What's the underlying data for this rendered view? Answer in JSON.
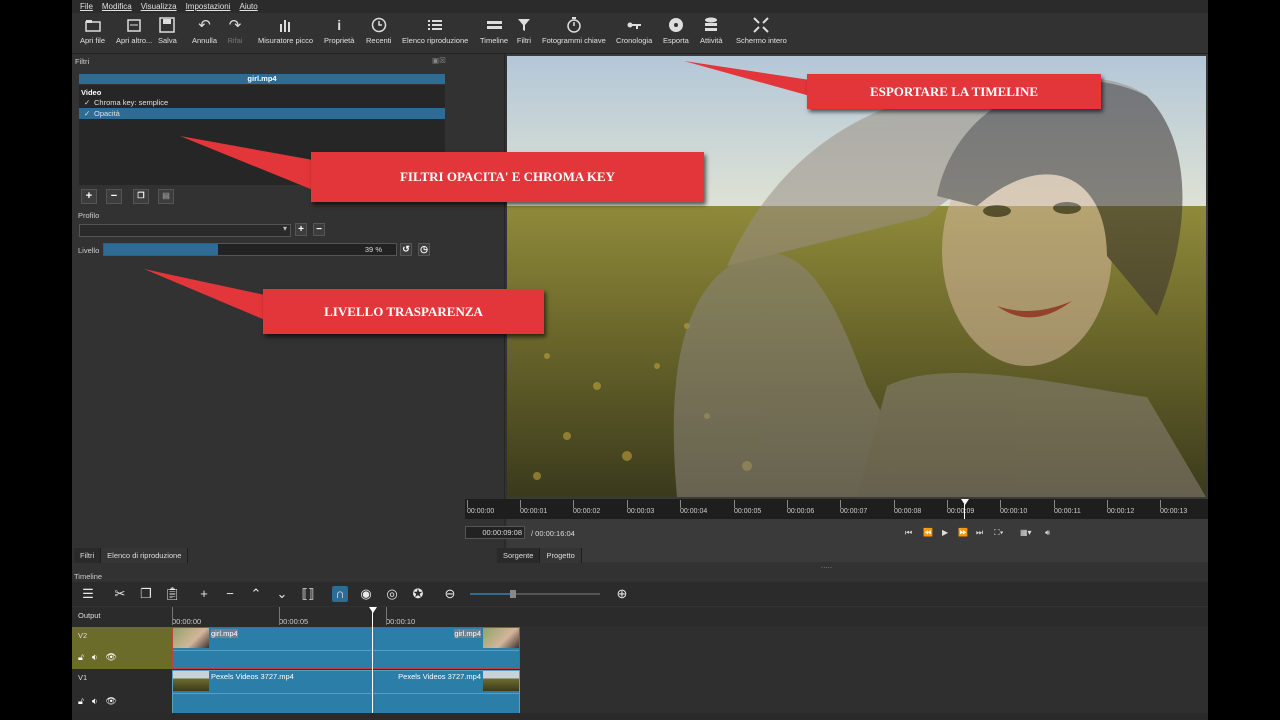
{
  "menu": [
    "File",
    "Modifica",
    "Visualizza",
    "Impostazioni",
    "Aiuto"
  ],
  "toolbar": [
    {
      "label": "Apri file",
      "icon": "folder-icon"
    },
    {
      "label": "Apri altro...",
      "icon": "folder-open-icon"
    },
    {
      "label": "Salva",
      "icon": "save-icon"
    },
    {
      "label": "Annulla",
      "icon": "undo-icon"
    },
    {
      "label": "Rifai",
      "icon": "redo-icon"
    },
    {
      "label": "Misuratore picco",
      "icon": "peak-meter-icon"
    },
    {
      "label": "Proprietà",
      "icon": "info-icon"
    },
    {
      "label": "Recenti",
      "icon": "clock-icon"
    },
    {
      "label": "Elenco riproduzione",
      "icon": "list-icon"
    },
    {
      "label": "Timeline",
      "icon": "timeline-icon"
    },
    {
      "label": "Filtri",
      "icon": "filter-icon"
    },
    {
      "label": "Fotogrammi chiave",
      "icon": "stopwatch-icon"
    },
    {
      "label": "Cronologia",
      "icon": "history-icon"
    },
    {
      "label": "Esporta",
      "icon": "export-disc-icon"
    },
    {
      "label": "Attività",
      "icon": "jobs-icon"
    },
    {
      "label": "Schermo intero",
      "icon": "fullscreen-icon"
    }
  ],
  "filters_panel": {
    "title": "Filtri",
    "clip_name": "girl.mp4",
    "group": "Video",
    "items": [
      {
        "check": "✓",
        "label": "Chroma key: semplice"
      },
      {
        "check": "✓",
        "label": "Opacità"
      }
    ],
    "profile_label": "Profilo",
    "level_label": "Livello",
    "level_value": "39 %",
    "level_fraction": 0.39
  },
  "left_tabs": [
    "Filtri",
    "Elenco di riproduzione"
  ],
  "player": {
    "ruler": [
      "00:00:00",
      "00:00:01",
      "00:00:02",
      "00:00:03",
      "00:00:04",
      "00:00:05",
      "00:00:06",
      "00:00:07",
      "00:00:08",
      "00:00:09",
      "00:00:10",
      "00:00:11",
      "00:00:12",
      "00:00:13"
    ],
    "current_time": "00:00:09:08",
    "total_time": "/ 00:00:16:04",
    "tabs": [
      "Sorgente",
      "Progetto"
    ]
  },
  "timeline": {
    "label": "Timeline",
    "ruler": [
      "00:00:00",
      "00:00:05",
      "00:00:10"
    ],
    "output_label": "Output",
    "tracks": [
      {
        "name": "V2",
        "clips": [
          "girl.mp4",
          "girl.mp4"
        ]
      },
      {
        "name": "V1",
        "clips": [
          "Pexels Videos 3727.mp4",
          "Pexels Videos 3727.mp4"
        ]
      }
    ]
  },
  "callouts": {
    "export": "ESPORTARE LA TIMELINE",
    "filters": "FILTRI OPACITA' E CHROMA KEY",
    "level": "LIVELLO TRASPARENZA"
  },
  "colors": {
    "accent": "#2d6d95",
    "callout": "#e2363a",
    "clip": "#2a7ea7"
  }
}
